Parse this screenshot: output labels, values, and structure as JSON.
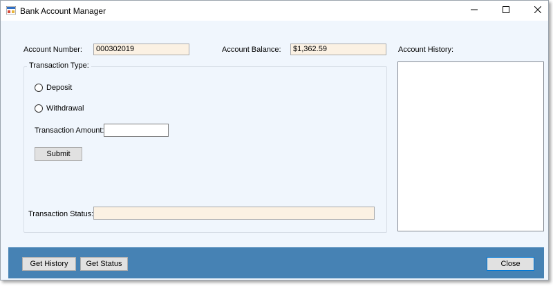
{
  "window": {
    "title": "Bank Account Manager",
    "icons": {
      "app": "app-icon",
      "minimize": "minimize-icon",
      "maximize": "maximize-icon",
      "close": "close-icon"
    }
  },
  "account": {
    "number_label": "Account Number:",
    "number_value": "000302019",
    "balance_label": "Account Balance:",
    "balance_value": "$1,362.59"
  },
  "transaction": {
    "group_title": "Transaction Type:",
    "options": [
      {
        "label": "Deposit",
        "selected": false
      },
      {
        "label": "Withdrawal",
        "selected": false
      }
    ],
    "amount_label": "Transaction Amount:",
    "amount_value": "",
    "submit_label": "Submit",
    "status_label": "Transaction Status:",
    "status_value": ""
  },
  "history": {
    "label": "Account History:",
    "items": []
  },
  "footer": {
    "get_history_label": "Get History",
    "get_status_label": "Get Status",
    "close_label": "Close"
  },
  "colors": {
    "window_bg": "#f0f6fd",
    "readonly_field_bg": "#fbf1e3",
    "footer_bg": "#4682b4",
    "button_bg": "#e1e1e1"
  }
}
